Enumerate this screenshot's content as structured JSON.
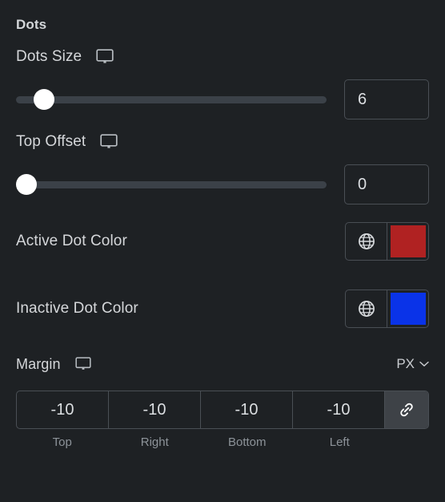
{
  "panel": {
    "section_title": "Dots",
    "background_color": "#1e2124"
  },
  "dots_size": {
    "label": "Dots Size",
    "responsive_icon": "monitor-icon",
    "value": "6",
    "slider": {
      "percent": 6
    }
  },
  "top_offset": {
    "label": "Top Offset",
    "responsive_icon": "monitor-icon",
    "value": "0",
    "slider": {
      "percent": 0
    }
  },
  "active_dot_color": {
    "label": "Active Dot Color",
    "globe_icon": "globe-icon",
    "color": "#b02222"
  },
  "inactive_dot_color": {
    "label": "Inactive Dot Color",
    "globe_icon": "globe-icon",
    "color": "#0a33e8"
  },
  "margin": {
    "label": "Margin",
    "responsive_icon": "monitor-icon",
    "unit": "PX",
    "unit_chevron_icon": "chevron-down-icon",
    "link_icon": "link-icon",
    "values": [
      "-10",
      "-10",
      "-10",
      "-10"
    ],
    "labels": [
      "Top",
      "Right",
      "Bottom",
      "Left"
    ]
  }
}
